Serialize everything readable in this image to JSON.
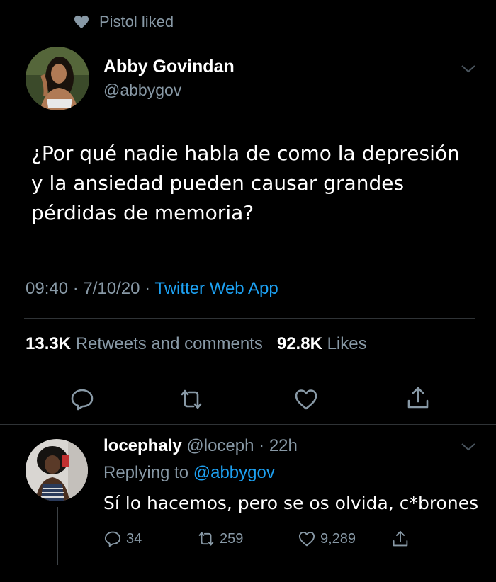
{
  "social_context": {
    "icon": "heart-icon",
    "text": "Pistol liked"
  },
  "tweet": {
    "author_name": "Abby Govindan",
    "author_handle": "@abbygov",
    "text": "¿Por qué nadie habla de como la depresión y la ansiedad pueden causar grandes pérdidas de memoria?",
    "time": "09:40",
    "date": "7/10/20",
    "separator": " · ",
    "source": "Twitter Web App",
    "retweets_count": "13.3K",
    "retweets_label": "Retweets and comments",
    "likes_count": "92.8K",
    "likes_label": "Likes"
  },
  "reply": {
    "author_name": "locephaly",
    "author_handle": "@loceph",
    "time_ago": "22h",
    "replying_prefix": "Replying to",
    "replying_to": "@abbygov",
    "text": "Sí lo hacemos, pero se os olvida, c*brones",
    "reply_count": "34",
    "retweet_count": "259",
    "like_count": "9,289"
  },
  "colors": {
    "background": "#000000",
    "accent": "#1da1f2",
    "muted": "#8899a6",
    "divider": "#2f3336"
  }
}
